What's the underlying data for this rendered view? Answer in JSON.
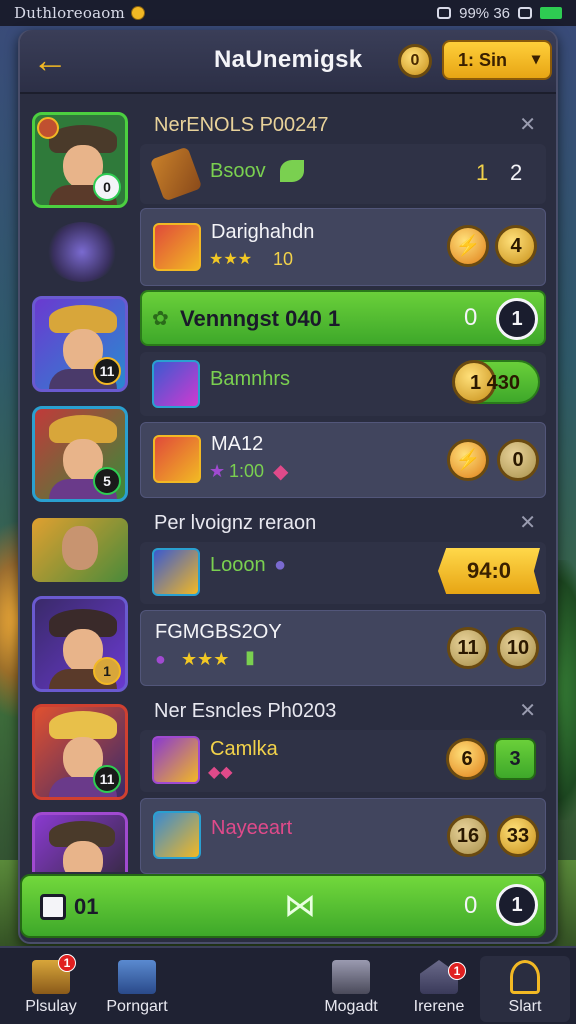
{
  "statusbar": {
    "carrier": "Duthloreoaom",
    "right_text": "99% 36"
  },
  "header": {
    "title": "NaUnemigsk",
    "coin": "0",
    "buy_label": "1: Sin"
  },
  "sections": [
    {
      "title": "NerENOLS P00247",
      "rows": [
        {
          "name": "Bsoov",
          "values": [
            "1",
            "2"
          ]
        },
        {
          "name": "Darighahdn",
          "stars": "★★★",
          "sub": "10",
          "values": [
            "",
            "4"
          ]
        }
      ]
    }
  ],
  "green_row": {
    "label": "Vennngst 040 1",
    "value": "0",
    "badge": "1"
  },
  "rows2": [
    {
      "name": "Bamnhrs",
      "value": "1 430"
    },
    {
      "name": "MA12",
      "sub": "1:00",
      "value": "0"
    }
  ],
  "section2": {
    "title": "Per lvoignz reraon",
    "rows": [
      {
        "name": "Looon",
        "value": "94:0"
      },
      {
        "name": "FGMGBS2OY",
        "stars": "★★★",
        "values": [
          "11",
          "10"
        ]
      }
    ]
  },
  "section3": {
    "title": "Ner Esncles Ph0203",
    "rows": [
      {
        "name": "Camlka",
        "values": [
          "6",
          "3"
        ]
      },
      {
        "name": "Nayeeart",
        "values": [
          "16",
          "33"
        ]
      }
    ]
  },
  "bottom": {
    "left": "01",
    "value": "0",
    "badge": "1"
  },
  "tabs": [
    {
      "label": "Plsulay",
      "badge": "1"
    },
    {
      "label": "Porngart",
      "badge": ""
    },
    {
      "label": "Mogadt",
      "badge": ""
    },
    {
      "label": "Irerene",
      "badge": "1"
    },
    {
      "label": "Slart",
      "badge": ""
    }
  ],
  "hero_levels": [
    "0",
    "",
    "11",
    "5",
    "",
    "1",
    "11",
    ""
  ],
  "colors": {
    "accent": "#f2b824",
    "green": "#4cbc2e",
    "panel": "#2a2d40"
  }
}
